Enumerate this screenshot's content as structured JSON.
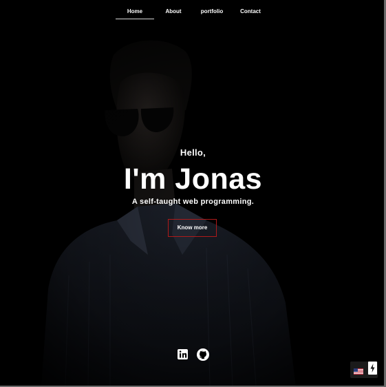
{
  "nav": {
    "items": [
      {
        "label": "Home",
        "active": true
      },
      {
        "label": "About",
        "active": false
      },
      {
        "label": "portfolio",
        "active": false
      },
      {
        "label": "Contact",
        "active": false
      }
    ]
  },
  "hero": {
    "greeting": "Hello,",
    "name": "I'm Jonas",
    "tagline": "A self-taught web programming.",
    "cta_label": "Know more"
  },
  "social": {
    "icons": [
      "linkedin-icon",
      "github-icon"
    ]
  },
  "widget": {
    "icons": [
      "us-flag-icon",
      "lightning-icon"
    ]
  },
  "colors": {
    "background": "#000000",
    "text": "#ffffff",
    "cta_border": "#b01a1a",
    "nav_underline": "#d8d8d8"
  }
}
